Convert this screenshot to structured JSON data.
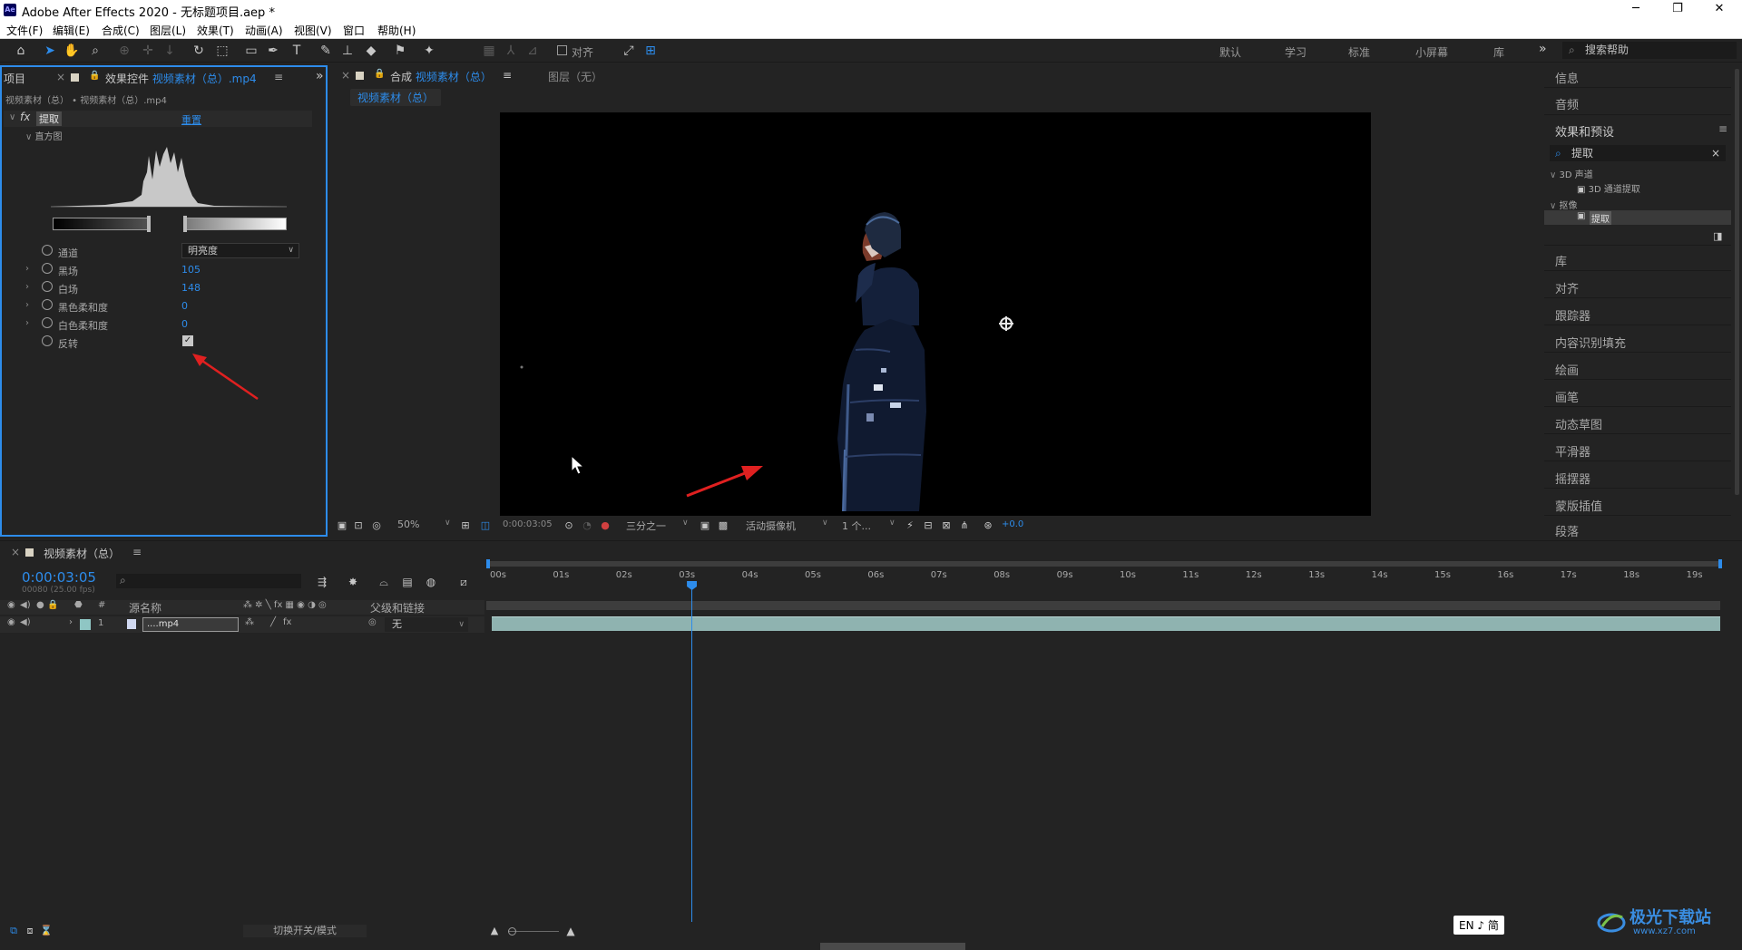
{
  "titlebar": {
    "app_icon": "Ae",
    "title": "Adobe After Effects 2020 - 无标题项目.aep *",
    "minimize": "─",
    "restore": "❐",
    "close": "✕"
  },
  "menu": [
    "文件(F)",
    "编辑(E)",
    "合成(C)",
    "图层(L)",
    "效果(T)",
    "动画(A)",
    "视图(V)",
    "窗口",
    "帮助(H)"
  ],
  "toolbar": {
    "align_label": "对齐",
    "workspaces": [
      "默认",
      "学习",
      "标准",
      "小屏幕",
      "库"
    ],
    "overflow": "»",
    "search_placeholder": "搜索帮助"
  },
  "project_tab": "项目",
  "effect_controls": {
    "tab_prefix": "效果控件",
    "tab_source": "视频素材（总）.mp4",
    "breadcrumb": "视频素材（总） • 视频素材（总）.mp4",
    "effect_fx": "fx",
    "effect_name": "提取",
    "reset": "重置",
    "histogram_label": "直方图",
    "properties": [
      {
        "label": "通道",
        "value": "明亮度"
      },
      {
        "label": "黑场",
        "value": "105"
      },
      {
        "label": "白场",
        "value": "148"
      },
      {
        "label": "黑色柔和度",
        "value": "0"
      },
      {
        "label": "白色柔和度",
        "value": "0"
      },
      {
        "label": "反转",
        "value": ""
      }
    ],
    "invert_checked": true
  },
  "composition": {
    "tab_prefix": "合成",
    "tab_name": "视频素材（总）",
    "layer_tab": "图层（无）",
    "breadcrumb": "视频素材（总）",
    "bottom_bar": {
      "zoom": "50%",
      "timecode": "0:00:03:05",
      "resolution": "三分之一",
      "camera": "活动摄像机",
      "views": "1 个...",
      "exposure": "+0.0"
    }
  },
  "right_panel": {
    "items_top": [
      "信息",
      "音频",
      "效果和预设"
    ],
    "search_value": "提取",
    "tree": [
      {
        "label": "3D 声道",
        "level": 0
      },
      {
        "label": "3D 通道提取",
        "level": 1
      },
      {
        "label": "抠像",
        "level": 0
      },
      {
        "label": "提取",
        "level": 1
      }
    ],
    "items_bottom": [
      "库",
      "对齐",
      "跟踪器",
      "内容识别填充",
      "绘画",
      "画笔",
      "动态草图",
      "平滑器",
      "摇摆器",
      "蒙版插值",
      "段落"
    ]
  },
  "timeline": {
    "tab": "视频素材（总）",
    "current_time": "0:00:03:05",
    "frame_info": "00080 (25.00 fps)",
    "columns": {
      "num": "#",
      "source": "源名称",
      "parent": "父级和链接"
    },
    "layer": {
      "index": "1",
      "name": "....mp4",
      "parent": "无"
    },
    "ruler": [
      "00s",
      "01s",
      "02s",
      "03s",
      "04s",
      "05s",
      "06s",
      "07s",
      "08s",
      "09s",
      "10s",
      "11s",
      "12s",
      "13s",
      "14s",
      "15s",
      "16s",
      "17s",
      "18s",
      "19s"
    ],
    "toggle_label": "切换开关/模式",
    "playhead_time_s": 3.2
  },
  "ime": {
    "label": "EN ♪ 简"
  },
  "watermark": {
    "text": "极光下载站",
    "url": "www.xz7.com"
  },
  "colors": {
    "accent": "#2d8ceb",
    "panel": "#232323",
    "track": "#8fb3b0",
    "arrow": "#e02020"
  }
}
